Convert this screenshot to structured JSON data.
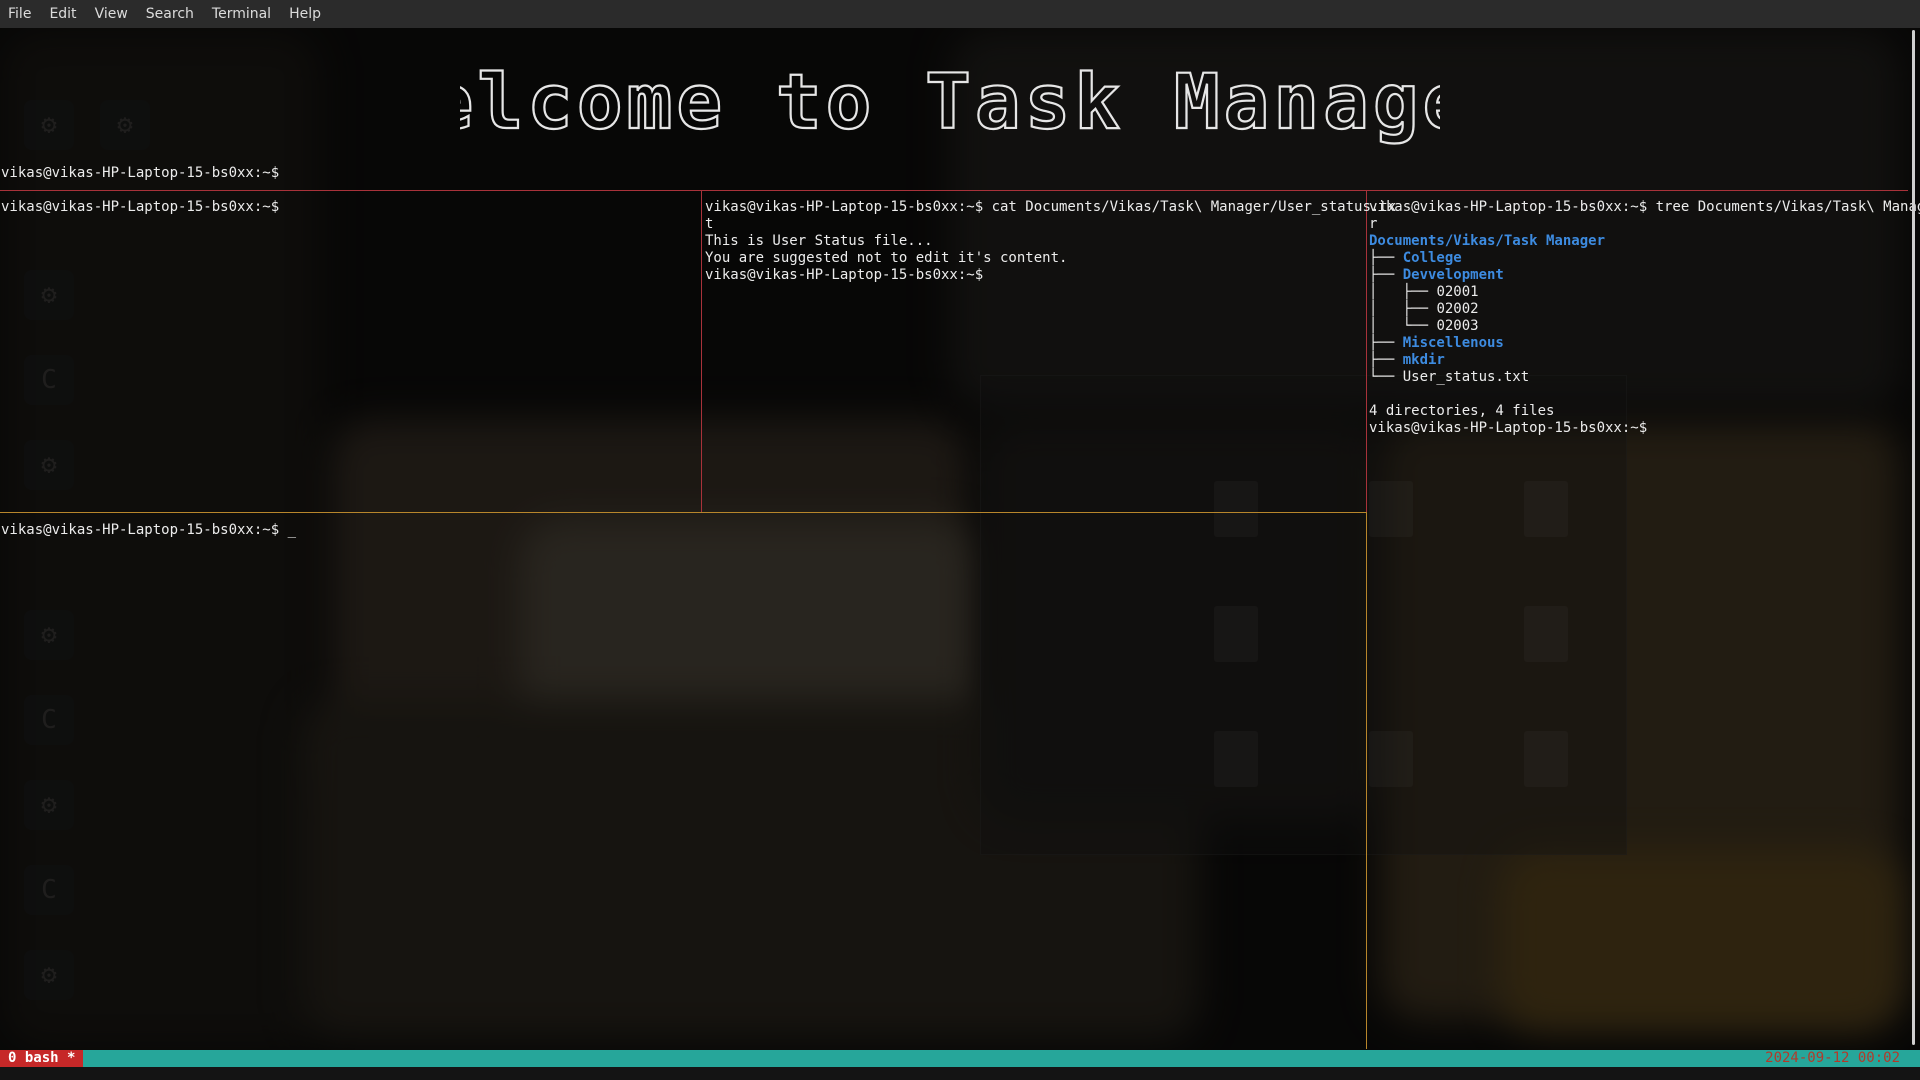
{
  "menubar": {
    "items": [
      "File",
      "Edit",
      "View",
      "Search",
      "Terminal",
      "Help"
    ]
  },
  "banner": {
    "text": "Welcome to Task Manager"
  },
  "panes": {
    "top": {
      "prompt": "vikas@vikas-HP-Laptop-15-bs0xx:~$"
    },
    "left_middle": {
      "prompt": "vikas@vikas-HP-Laptop-15-bs0xx:~$"
    },
    "middle": {
      "command_line_1": "vikas@vikas-HP-Laptop-15-bs0xx:~$ cat Documents/Vikas/Task\\ Manager/User_status.tx",
      "command_line_2": "t",
      "output_1": "This is User Status file...",
      "output_2": "You are suggested not to edit it's content.",
      "prompt": "vikas@vikas-HP-Laptop-15-bs0xx:~$"
    },
    "right": {
      "command_line_1": "vikas@vikas-HP-Laptop-15-bs0xx:~$ tree Documents/Vikas/Task\\ Manage",
      "command_line_2": "r",
      "root": "Documents/Vikas/Task Manager",
      "tree": [
        {
          "prefix": "├── ",
          "name": "College",
          "is_dir": true
        },
        {
          "prefix": "├── ",
          "name": "Devvelopment",
          "is_dir": true
        },
        {
          "prefix": "│   ├── ",
          "name": "02001",
          "is_dir": false
        },
        {
          "prefix": "│   ├── ",
          "name": "02002",
          "is_dir": false
        },
        {
          "prefix": "│   └── ",
          "name": "02003",
          "is_dir": false
        },
        {
          "prefix": "├── ",
          "name": "Miscellenous",
          "is_dir": true
        },
        {
          "prefix": "├── ",
          "name": "mkdir",
          "is_dir": true
        },
        {
          "prefix": "└── ",
          "name": "User_status.txt",
          "is_dir": false
        }
      ],
      "summary": "4 directories, 4 files",
      "prompt": "vikas@vikas-HP-Laptop-15-bs0xx:~$"
    },
    "bottom": {
      "prompt": "vikas@vikas-HP-Laptop-15-bs0xx:~$ _"
    }
  },
  "statusbar": {
    "window": "0 bash *",
    "clock": "2024-09-12 00:02"
  },
  "colors": {
    "pane_border_red": "#a8323a",
    "pane_border_orange": "#b8862b",
    "status_green": "#26a69a",
    "status_red": "#c62828",
    "directory_blue": "#3d8be0"
  }
}
